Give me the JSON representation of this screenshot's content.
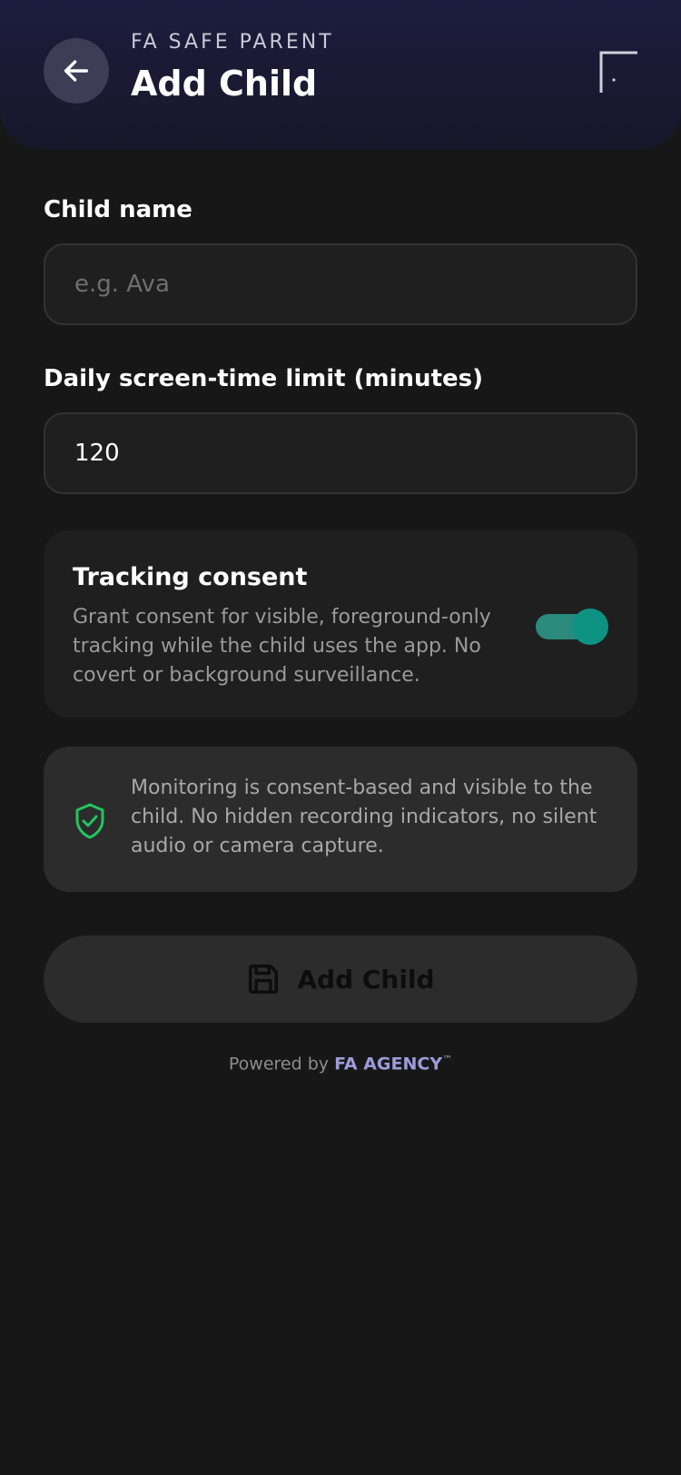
{
  "header": {
    "app_name": "FA SAFE PARENT",
    "title": "Add Child",
    "back_icon": "arrow-left-icon",
    "corner_icon": "corner-bracket-icon"
  },
  "form": {
    "child_name_label": "Child name",
    "child_name_placeholder": "e.g. Ava",
    "child_name_value": "",
    "screen_time_label": "Daily screen-time limit (minutes)",
    "screen_time_value": "120"
  },
  "consent": {
    "title": "Tracking consent",
    "description": "Grant consent for visible, foreground-only tracking while the child uses the app. No covert or background surveillance.",
    "enabled": true
  },
  "notice": {
    "icon": "shield-check-icon",
    "text": "Monitoring is consent-based and visible to the child. No hidden recording indicators, no silent audio or camera capture."
  },
  "submit": {
    "label": "Add Child",
    "icon": "save-icon"
  },
  "footer": {
    "prefix": "Powered by",
    "brand": "FA AGENCY",
    "trademark": "™"
  },
  "colors": {
    "background": "#171717",
    "header": "#1c1c3e",
    "toggle_on": "#0e9383",
    "shield": "#22c55e",
    "brand": "#9c9cd8"
  }
}
